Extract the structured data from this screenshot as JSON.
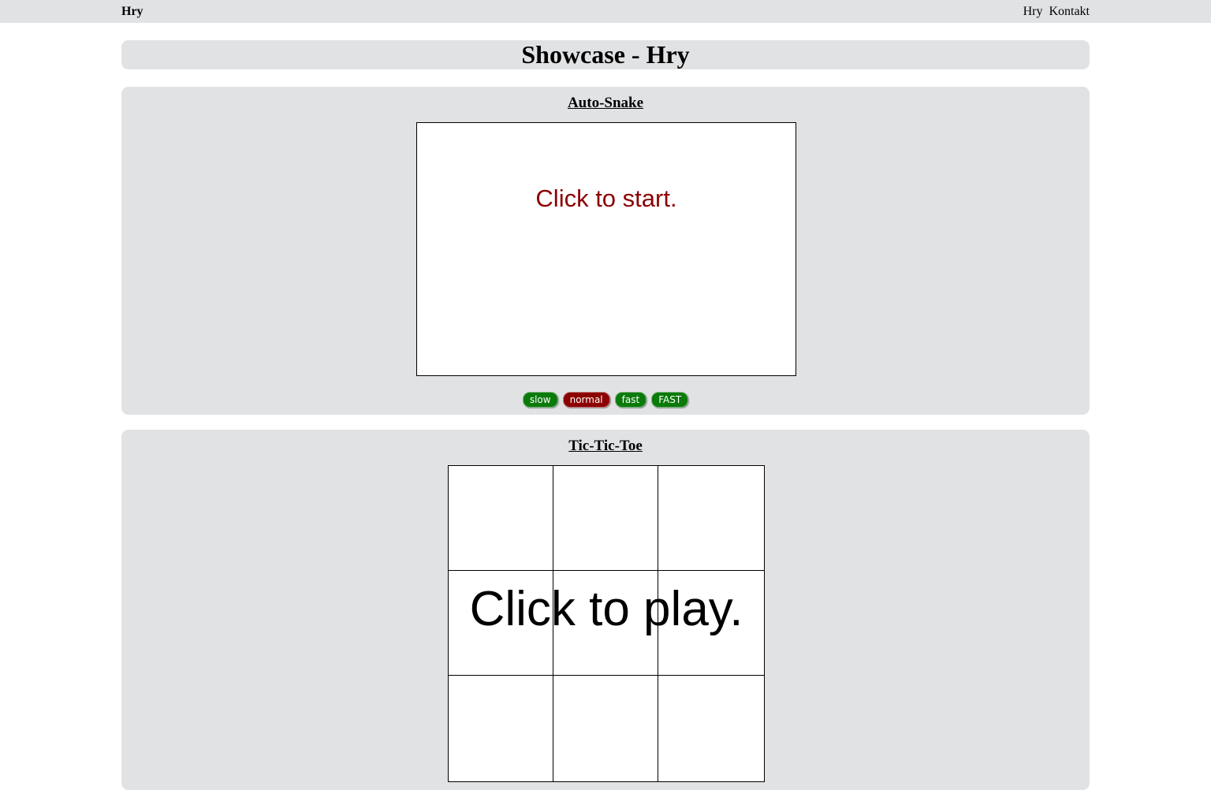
{
  "header": {
    "brand": "Hry",
    "nav": [
      {
        "label": "Hry"
      },
      {
        "label": "Kontakt"
      }
    ]
  },
  "page": {
    "title": "Showcase - Hry"
  },
  "snake": {
    "heading": "Auto-Snake",
    "message": "Click to start.",
    "message_color": "#8b0000",
    "speeds": [
      {
        "label": "slow",
        "active": false
      },
      {
        "label": "normal",
        "active": true
      },
      {
        "label": "fast",
        "active": false
      },
      {
        "label": "FAST",
        "active": false
      }
    ],
    "active_color": "#8b0000",
    "inactive_color": "#0a7a0a"
  },
  "tictactoe": {
    "heading": "Tic-Tic-Toe",
    "message": "Click to play."
  }
}
